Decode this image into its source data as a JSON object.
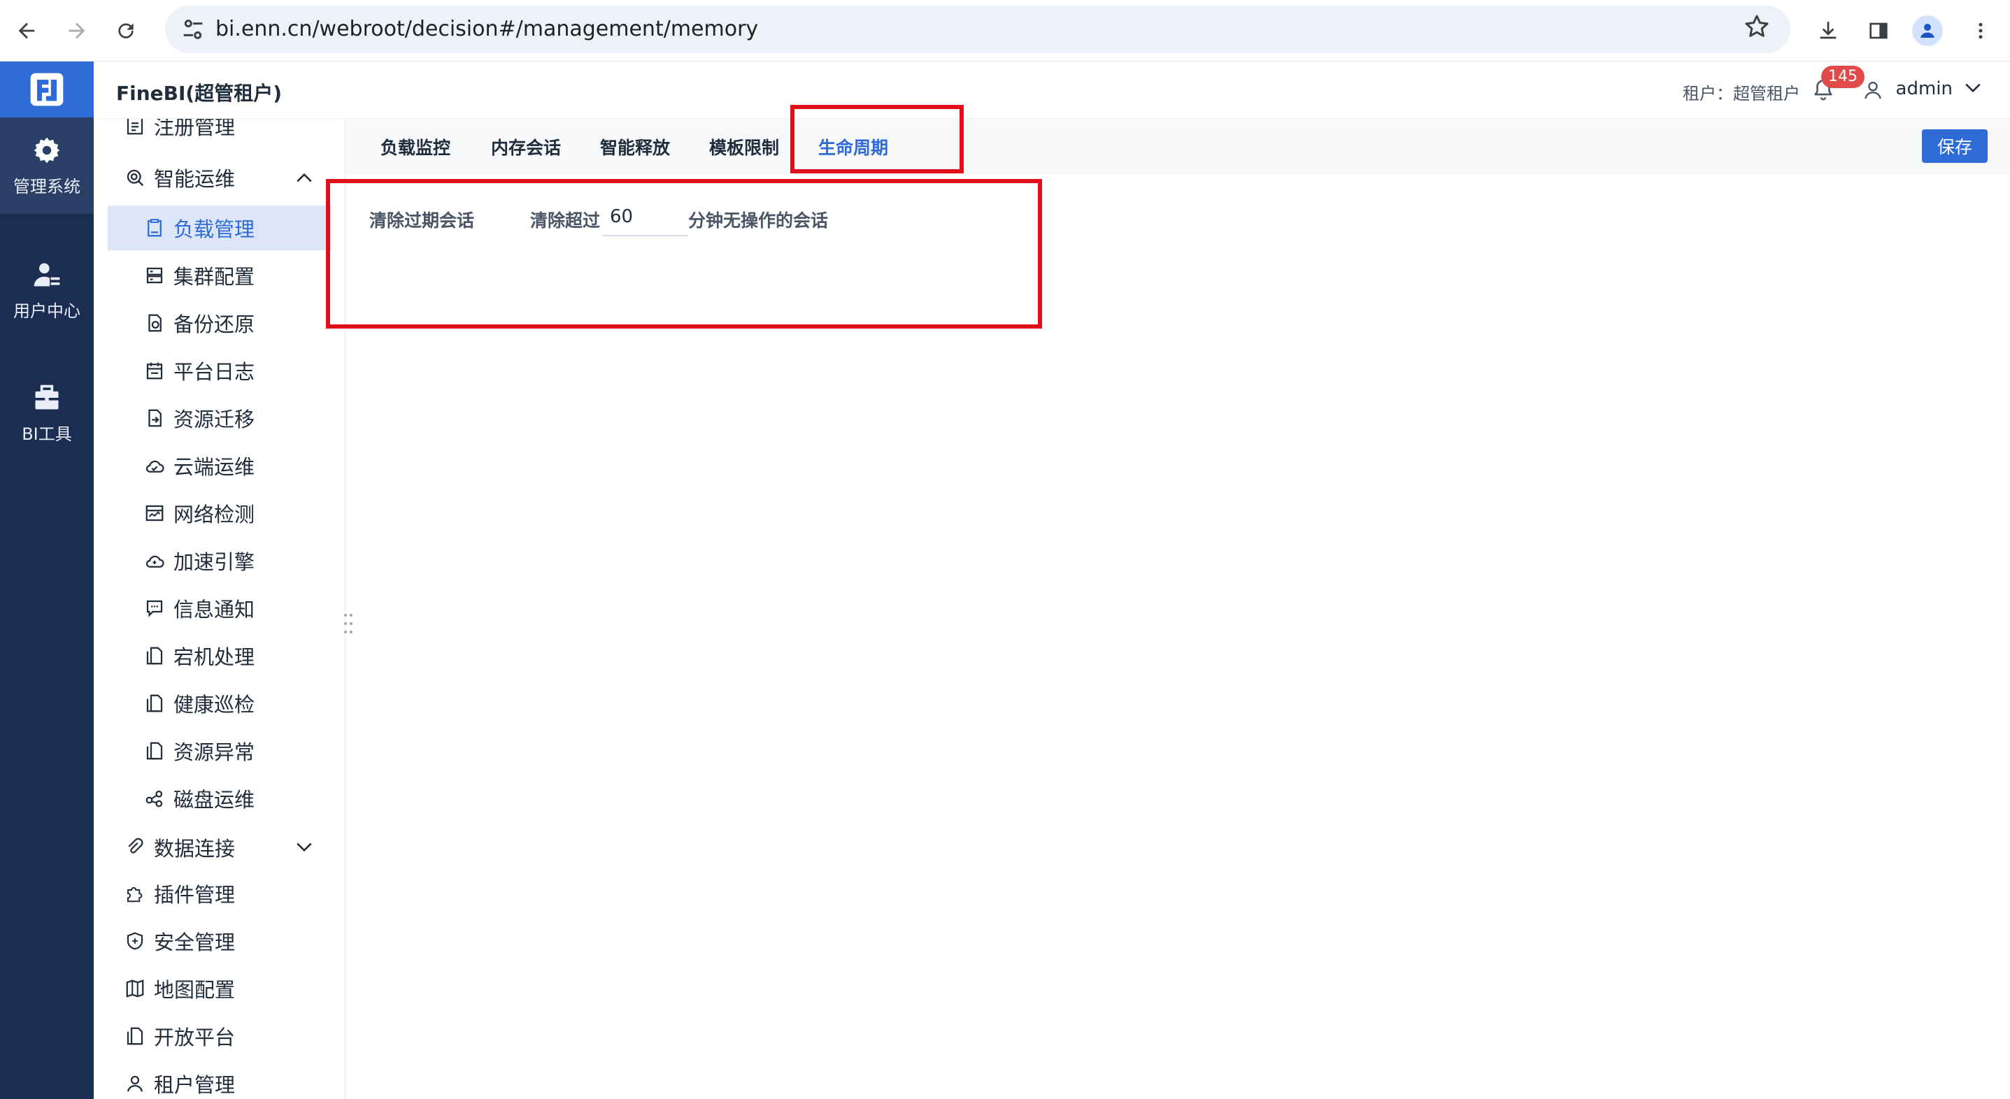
{
  "browser": {
    "url": "bi.enn.cn/webroot/decision#/management/memory"
  },
  "rail": {
    "items": [
      {
        "label": "管理系统",
        "icon": "gear-icon"
      },
      {
        "label": "用户中心",
        "icon": "user-icon"
      },
      {
        "label": "BI工具",
        "icon": "toolbox-icon"
      }
    ]
  },
  "header": {
    "title": "FineBI(超管租户)",
    "tenant": "租户：超管租户",
    "notification_count": "145",
    "user": "admin"
  },
  "sidebar": {
    "items": [
      {
        "label": "注册管理",
        "icon": "register-icon",
        "level": 1
      },
      {
        "label": "智能运维",
        "icon": "ops-icon",
        "level": 1,
        "expanded": true
      },
      {
        "label": "负载管理",
        "icon": "load-icon",
        "level": 2,
        "selected": true
      },
      {
        "label": "集群配置",
        "icon": "cluster-icon",
        "level": 2
      },
      {
        "label": "备份还原",
        "icon": "backup-icon",
        "level": 2
      },
      {
        "label": "平台日志",
        "icon": "log-icon",
        "level": 2
      },
      {
        "label": "资源迁移",
        "icon": "migrate-icon",
        "level": 2
      },
      {
        "label": "云端运维",
        "icon": "cloud-icon",
        "level": 2
      },
      {
        "label": "网络检测",
        "icon": "network-icon",
        "level": 2
      },
      {
        "label": "加速引擎",
        "icon": "engine-icon",
        "level": 2
      },
      {
        "label": "信息通知",
        "icon": "message-icon",
        "level": 2
      },
      {
        "label": "宕机处理",
        "icon": "crash-icon",
        "level": 2
      },
      {
        "label": "健康巡检",
        "icon": "health-icon",
        "level": 2
      },
      {
        "label": "资源异常",
        "icon": "resource-icon",
        "level": 2
      },
      {
        "label": "磁盘运维",
        "icon": "disk-icon",
        "level": 2
      },
      {
        "label": "数据连接",
        "icon": "link-icon",
        "level": 1,
        "expanded": false
      },
      {
        "label": "插件管理",
        "icon": "plugin-icon",
        "level": 1
      },
      {
        "label": "安全管理",
        "icon": "shield-icon",
        "level": 1
      },
      {
        "label": "地图配置",
        "icon": "map-icon",
        "level": 1
      },
      {
        "label": "开放平台",
        "icon": "platform-icon",
        "level": 1
      },
      {
        "label": "租户管理",
        "icon": "tenant-icon",
        "level": 1
      }
    ]
  },
  "tabs": [
    {
      "label": "负载监控"
    },
    {
      "label": "内存会话"
    },
    {
      "label": "智能释放"
    },
    {
      "label": "模板限制"
    },
    {
      "label": "生命周期",
      "active": true
    }
  ],
  "toolbar": {
    "save_label": "保存"
  },
  "form": {
    "section_label": "清除过期会话",
    "prefix_label": "清除超过",
    "minutes_value": "60",
    "suffix_label": "分钟无操作的会话"
  },
  "colors": {
    "primary": "#2f6bd6",
    "rail_bg": "#1b2d52",
    "highlight_border": "#e0101a",
    "badge": "#e24a4a"
  }
}
